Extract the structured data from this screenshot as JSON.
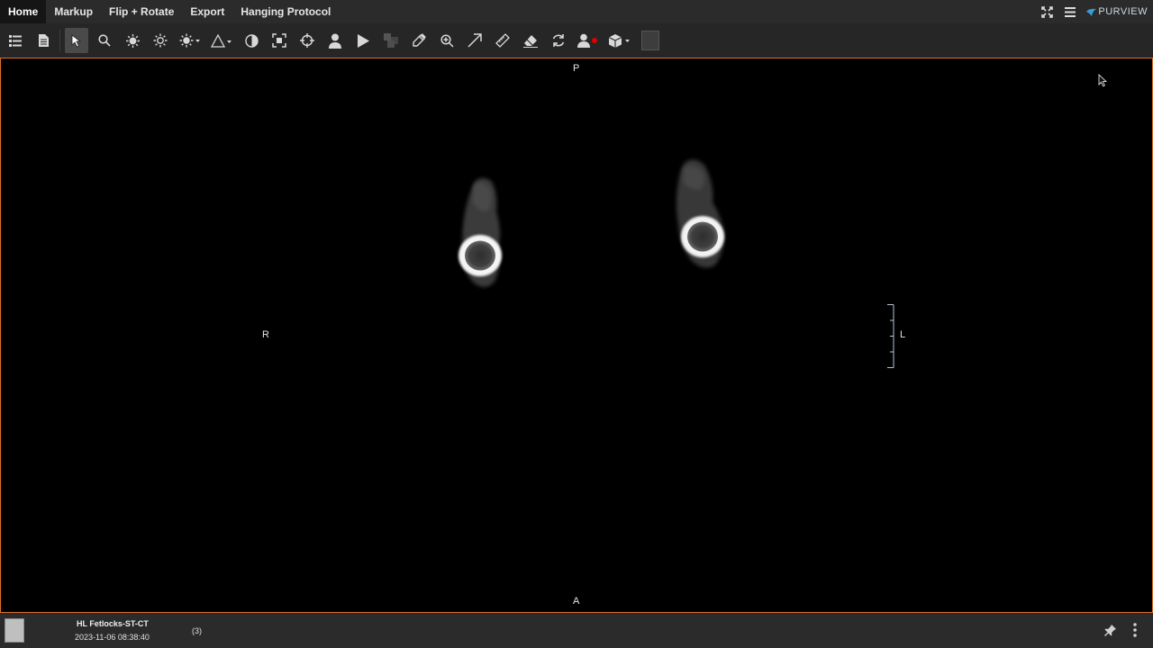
{
  "menu": {
    "tabs": [
      {
        "label": "Home"
      },
      {
        "label": "Markup"
      },
      {
        "label": "Flip + Rotate"
      },
      {
        "label": "Export"
      },
      {
        "label": "Hanging Protocol"
      }
    ],
    "brand": "PURVIEW",
    "right_icons": [
      "fullscreen-icon",
      "hamburger-menu-icon"
    ]
  },
  "toolbar": {
    "tools": [
      "list-icon",
      "document-icon",
      "pointer-icon",
      "magnify-icon",
      "brightness-icon",
      "brightness-auto-icon",
      "brightness-dropdown-icon",
      "shape-dropdown-icon",
      "contrast-icon",
      "fit-icon",
      "crosshair-icon",
      "person-icon",
      "play-icon",
      "layers-icon",
      "eyedropper-icon",
      "zoom-in-icon",
      "arrow-icon",
      "ruler-icon",
      "eraser-icon",
      "refresh-icon",
      "annotation-user-icon",
      "cube-dropdown-icon"
    ],
    "active_tool": "pointer-icon"
  },
  "viewport": {
    "orientation": {
      "top": "P",
      "bottom": "A",
      "left": "R",
      "right": "L"
    },
    "border_color": "#e0702b"
  },
  "status": {
    "series_name": "HL Fetlocks-ST-CT",
    "series_date": "2023-11-06 08:38:40",
    "image_count": "(3)"
  }
}
